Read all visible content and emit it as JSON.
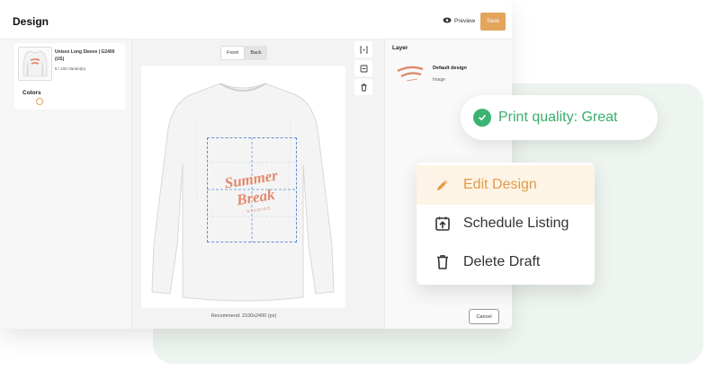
{
  "app": {
    "title": "Design",
    "preview_label": "Preview",
    "save_label": "Save"
  },
  "product": {
    "name": "Unisex Long Sleeve | G2400 (US)",
    "variants": "8 / 100 Variant(s)",
    "colors_label": "Colors"
  },
  "canvas": {
    "tabs": [
      "Front",
      "Back"
    ],
    "active_tab": "Front",
    "recommend": "Recommend: 2100x2400 (px)",
    "design_text": {
      "line1": "Summer",
      "line2": "Break",
      "line3": "STUDIOS"
    },
    "tools": [
      "center-icon",
      "layers-icon",
      "trash-icon"
    ]
  },
  "layers": {
    "title": "Layer",
    "items": [
      {
        "name": "Default design",
        "type": "Image"
      }
    ],
    "cancel_label": "Cancel"
  },
  "quality": {
    "text": "Print quality: Great"
  },
  "menu": {
    "items": [
      {
        "label": "Edit Design",
        "icon": "pencil-icon",
        "active": true
      },
      {
        "label": "Schedule Listing",
        "icon": "calendar-upload-icon",
        "active": false
      },
      {
        "label": "Delete Draft",
        "icon": "trash-icon",
        "active": false
      }
    ]
  },
  "colors": {
    "accent": "#e2a55b",
    "success": "#3cb371",
    "print_area": "#5b8fd6",
    "design_text": "#e08a6c",
    "background_panel": "#eef4ef"
  }
}
